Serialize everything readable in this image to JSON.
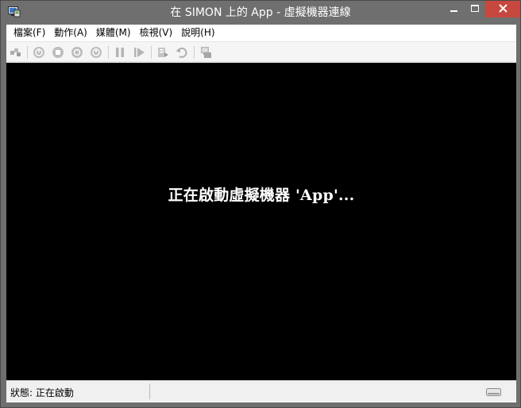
{
  "window": {
    "title": "在 SIMON 上的 App - 虛擬機器連線",
    "icon": "vm-connection-icon",
    "controls": [
      "minimize-icon",
      "maximize-icon",
      "close-icon"
    ],
    "close_color": "#c7483e",
    "frame_color": "#6f6f6f"
  },
  "menu": {
    "items": [
      {
        "label": "檔案(F)"
      },
      {
        "label": "動作(A)"
      },
      {
        "label": "媒體(M)"
      },
      {
        "label": "檢視(V)"
      },
      {
        "label": "說明(H)"
      }
    ]
  },
  "toolbar": {
    "buttons": [
      "ctrl-alt-del-icon",
      "start-icon",
      "turn-off-icon",
      "shut-down-icon",
      "save-icon",
      "pause-icon",
      "resume-icon",
      "checkpoint-icon",
      "revert-icon",
      "enhanced-session-icon"
    ]
  },
  "console": {
    "message": "正在啟動虛擬機器 'App'...",
    "background": "#000000"
  },
  "status": {
    "text": "狀態: 正在啟動",
    "indicator_icon": "keyboard-icon"
  }
}
